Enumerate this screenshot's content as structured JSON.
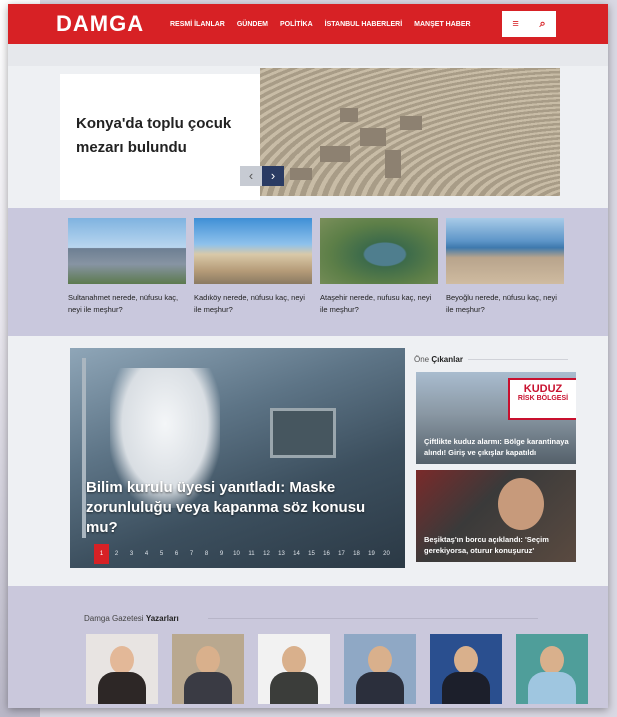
{
  "header": {
    "logo": "DAMGA",
    "nav": [
      "RESMİ İLANLAR",
      "GÜNDEM",
      "POLİTİKA",
      "İSTANBUL HABERLERİ",
      "MANŞET HABER"
    ],
    "menu_icon": "≡",
    "search_icon": "⌕",
    "brand_color": "#d72125"
  },
  "hero": {
    "title": "Konya'da toplu çocuk mezarı bulundu",
    "prev": "‹",
    "next": "›"
  },
  "thumbs": [
    {
      "caption": "Sultanahmet nerede, nüfusu kaç, neyi ile meşhur?"
    },
    {
      "caption": "Kadıköy nerede, nüfusu kaç, neyi ile meşhur?"
    },
    {
      "caption": "Ataşehir nerede, nufusu kaç, neyi ile meşhur?"
    },
    {
      "caption": "Beyoğlu nerede, nüfusu kaç, neyi ile meşhur?"
    }
  ],
  "featured": {
    "title": "Bilim kurulu üyesi yanıtladı: Maske zorunluluğu veya kapanma söz konusu mu?",
    "pages": [
      "1",
      "2",
      "3",
      "4",
      "5",
      "6",
      "7",
      "8",
      "9",
      "10",
      "11",
      "12",
      "13",
      "14",
      "15",
      "16",
      "17",
      "18",
      "19",
      "20"
    ],
    "active_page": "1"
  },
  "one_cikanlar": {
    "label_prefix": "Öne",
    "label_bold": "Çıkanlar",
    "items": [
      {
        "text": "Çiftlikte kuduz alarmı: Bölge karantinaya alındı! Giriş ve çıkışlar kapatıldı",
        "sign_line1": "KUDUZ",
        "sign_line2": "RİSK BÖLGESİ"
      },
      {
        "text": "Beşiktaş'ın borcu açıklandı: 'Seçim gerekiyorsa, oturur konuşuruz'"
      }
    ]
  },
  "authors": {
    "title_prefix": "Damga Gazetesi",
    "title_bold": "Yazarları"
  }
}
